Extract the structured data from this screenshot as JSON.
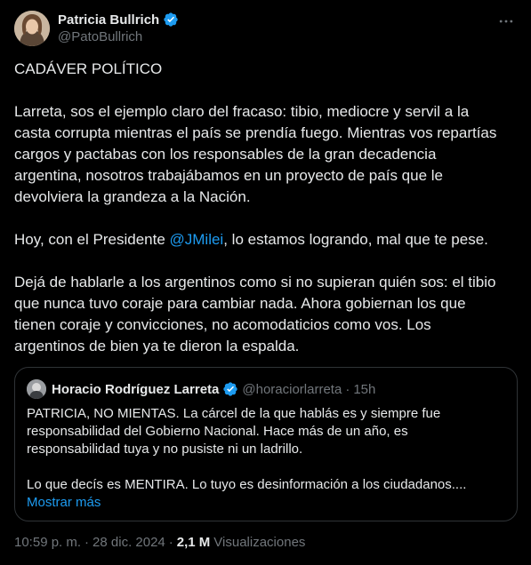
{
  "author": {
    "name": "Patricia Bullrich",
    "handle": "@PatoBullrich"
  },
  "colors": {
    "background": "#000000",
    "text": "#e7e9ea",
    "secondary": "#71767b",
    "link": "#1d9bf0",
    "verified": "#1d9bf0",
    "border": "#2f3336"
  },
  "icons": {
    "verified": "verified-badge-icon",
    "more": "more-options-icon"
  },
  "tweet": {
    "title": "CADÁVER POLÍTICO",
    "p1_lines": [
      "Larreta, sos el ejemplo claro del fracaso: tibio, mediocre y servil a la",
      "casta corrupta mientras el país se prendía fuego. Mientras vos repartías",
      "cargos y pactabas con los responsables de la gran decadencia",
      "argentina, nosotros trabajábamos en un proyecto de país que le",
      "devolviera la grandeza a la Nación."
    ],
    "p2_before": "Hoy, con el Presidente ",
    "p2_mention": "@JMilei",
    "p2_after": ", lo estamos logrando, mal que te pese.",
    "p3_lines": [
      "Dejá de hablarle a los argentinos como si no supieran quién sos: el tibio",
      "que nunca tuvo coraje para cambiar nada. Ahora gobiernan los que",
      "tienen coraje y convicciones, no acomodaticios como vos. Los",
      "argentinos de bien ya te dieron la espalda."
    ]
  },
  "quote": {
    "name": "Horacio Rodríguez Larreta",
    "handle": "@horaciorlarreta",
    "separator": "·",
    "time": "15h",
    "p1_lines": [
      "PATRICIA, NO MIENTAS. La cárcel de la que hablás es y siempre fue",
      "responsabilidad del Gobierno Nacional. Hace más de un año, es",
      "responsabilidad tuya y no pusiste ni un ladrillo."
    ],
    "p2_line": "Lo que decís es MENTIRA. Lo tuyo es desinformación a los ciudadanos....",
    "show_more": "Mostrar más"
  },
  "footer": {
    "time": "10:59 p. m.",
    "sep1": "·",
    "date": "28 dic. 2024",
    "sep2": "·",
    "views_count": "2,1 M",
    "views_label": "Visualizaciones"
  }
}
